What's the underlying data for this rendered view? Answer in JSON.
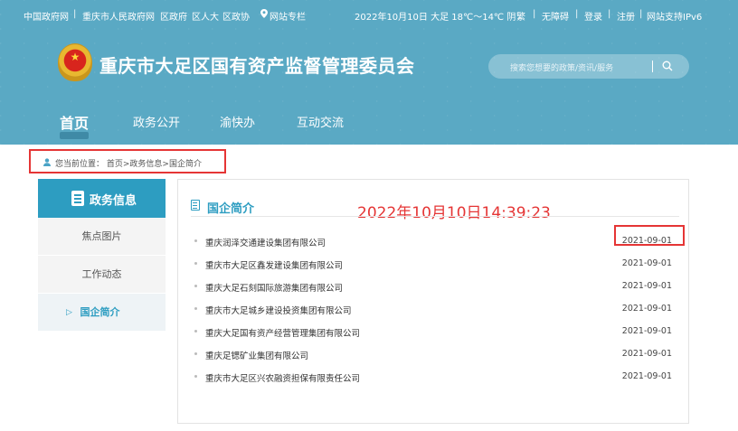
{
  "top_bar": {
    "links": [
      "中国政府网",
      "重庆市人民政府网",
      "区政府",
      "区人大",
      "区政协"
    ],
    "location_link": "网站专栏",
    "weather": "2022年10月10日  大足 18℃～14℃ 阴",
    "right_links": [
      "繁",
      "无障碍",
      "登录",
      "注册",
      "网站支持IPv6"
    ]
  },
  "header": {
    "site_title": "重庆市大足区国有资产监督管理委员会",
    "search_placeholder": "搜索您想要的政策/资讯/服务",
    "search_icon": "search-icon"
  },
  "nav": {
    "items": [
      "首页",
      "政务公开",
      "渝快办",
      "互动交流"
    ],
    "active": "首页"
  },
  "breadcrumb": {
    "prefix": "您当前位置：",
    "path": "首页>政务信息>国企简介"
  },
  "sidebar": {
    "title": "政务信息",
    "items": [
      "焦点图片",
      "工作动态",
      "国企简介"
    ],
    "active_index": 2
  },
  "content": {
    "title": "国企简介",
    "timestamp_overlay": "2022年10月10日14:39:23",
    "articles": [
      {
        "title": "重庆润泽交通建设集团有限公司",
        "date": "2021-09-01"
      },
      {
        "title": "重庆市大足区鑫发建设集团有限公司",
        "date": "2021-09-01"
      },
      {
        "title": "重庆大足石刻国际旅游集团有限公司",
        "date": "2021-09-01"
      },
      {
        "title": "重庆市大足城乡建设投资集团有限公司",
        "date": "2021-09-01"
      },
      {
        "title": "重庆大足国有资产经营管理集团有限公司",
        "date": "2021-09-01"
      },
      {
        "title": "重庆足锶矿业集团有限公司",
        "date": "2021-09-01"
      },
      {
        "title": "重庆市大足区兴农融资担保有限责任公司",
        "date": "2021-09-01"
      }
    ]
  },
  "colors": {
    "header_bg": "#5aa9c4",
    "accent": "#2d9dc1",
    "highlight": "#e53535"
  }
}
